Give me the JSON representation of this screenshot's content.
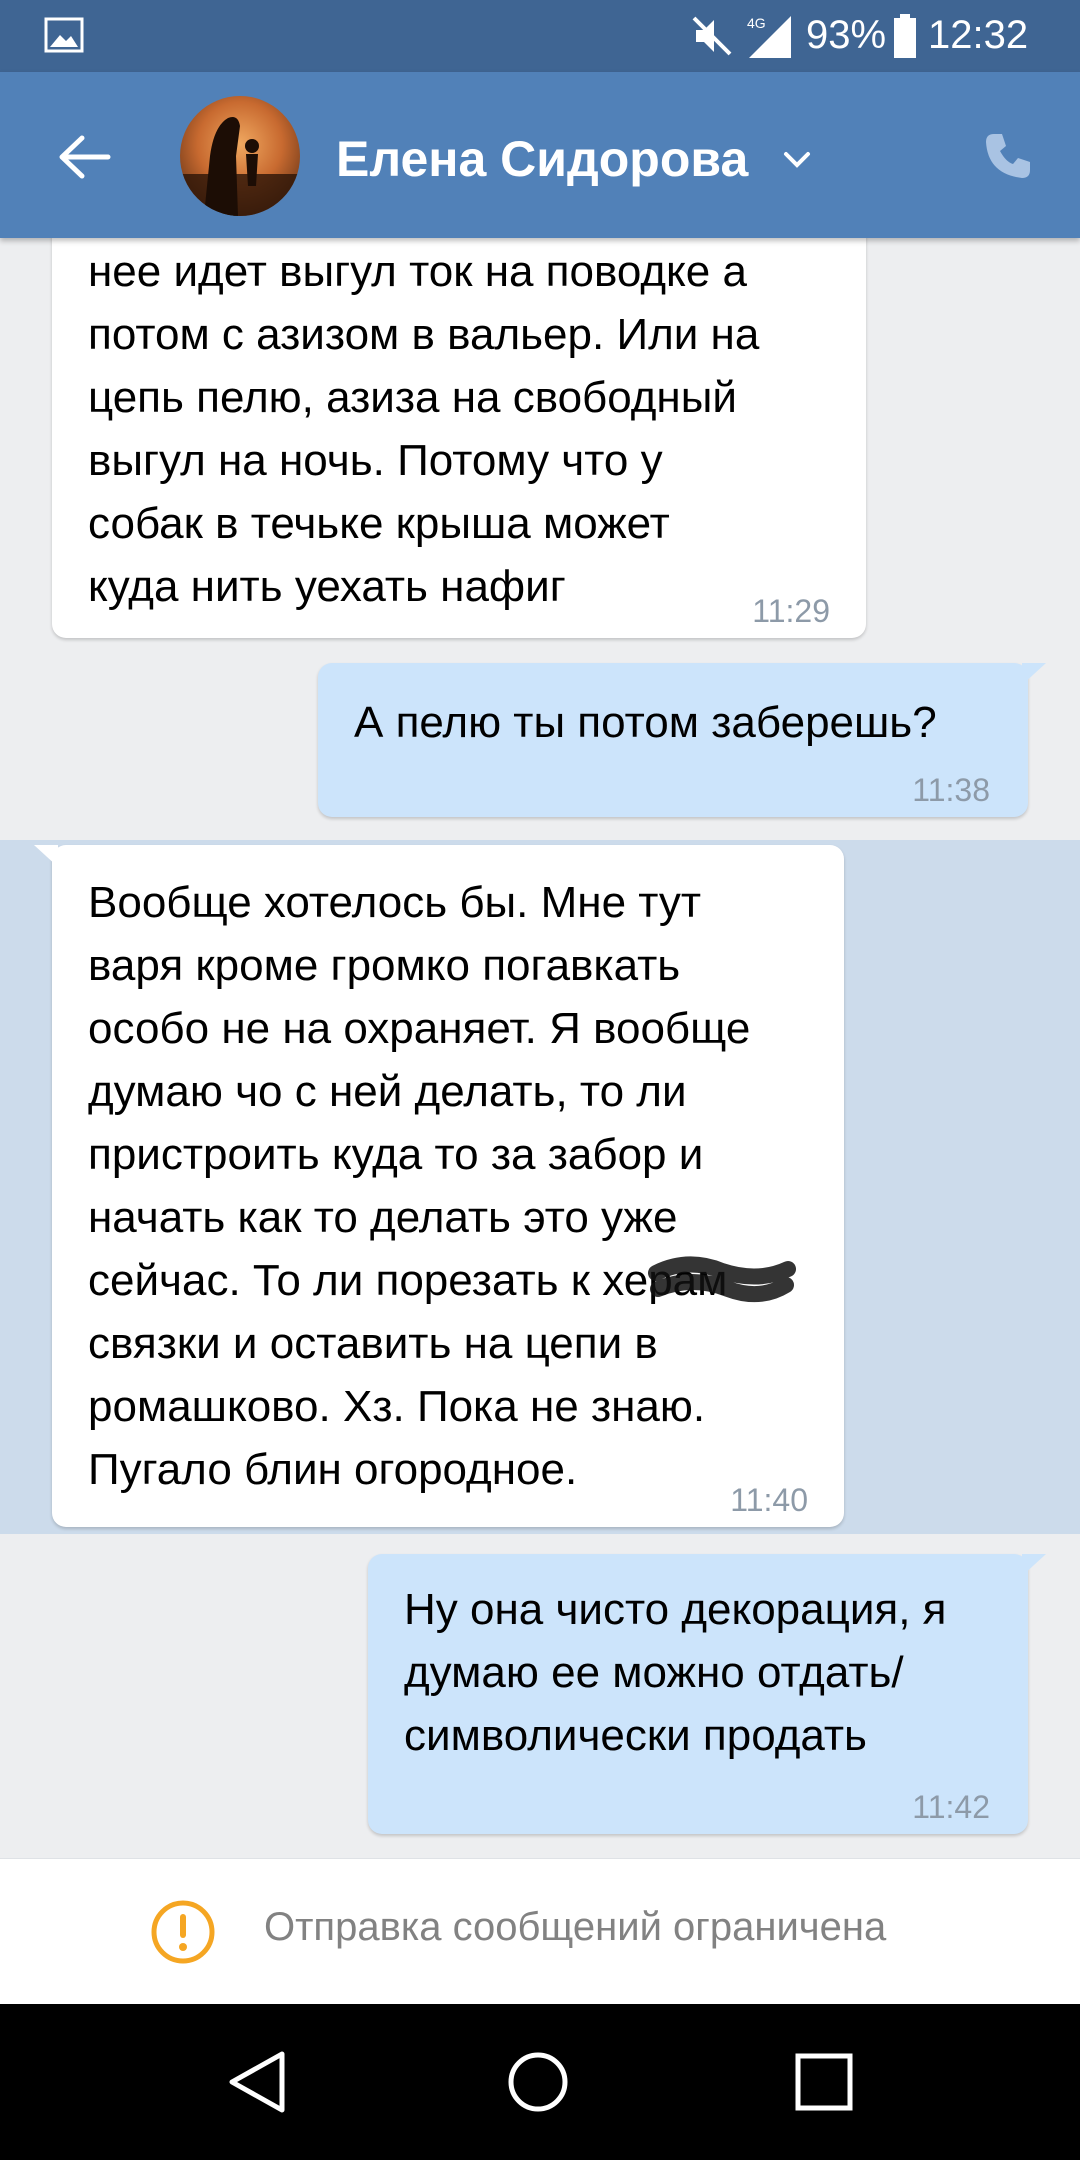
{
  "status_bar": {
    "network": "4G",
    "battery": "93%",
    "time": "12:32"
  },
  "header": {
    "contact_name": "Елена Сидорова",
    "back_icon": "arrow-left-icon",
    "call_icon": "phone-icon"
  },
  "messages": [
    {
      "direction": "incoming",
      "text": "нее идет выгул ток на поводке а\nпотом с азизом в вальер. Или на\nцепь пелю, азиза на свободный\nвыгул на ночь. Потому что у\nсобак в течьке крыша может\nкуда нить уехать нафиг",
      "time": "11:29"
    },
    {
      "direction": "outgoing",
      "text": "А пелю ты потом заберешь?",
      "time": "11:38"
    },
    {
      "direction": "incoming",
      "highlighted": true,
      "text": "Вообще хотелось бы. Мне тут\nваря кроме громко погавкать\nособо не на охраняет. Я вообще\nдумаю чо с ней делать, то ли\nпристроить куда то за забор и\nначать как то делать это уже\nсейчас. То ли порезать к херам\nсвязки и оставить на цепи в\nромашково. Хз. Пока не знаю.\nПугало блин огородное.",
      "time": "11:40"
    },
    {
      "direction": "outgoing",
      "text": "Ну она чисто декорация, я\nдумаю ее можно отдать/\nсимволически продать",
      "time": "11:42"
    }
  ],
  "restricted": {
    "text": "Отправка сообщений ограничена",
    "icon": "warning-icon",
    "icon_color": "#f5a623"
  },
  "colors": {
    "header": "#5181b8",
    "status_bar": "#3f6593",
    "outgoing_bubble": "#cce4fb",
    "incoming_bubble": "#ffffff",
    "highlight": "#ccdbeb"
  }
}
